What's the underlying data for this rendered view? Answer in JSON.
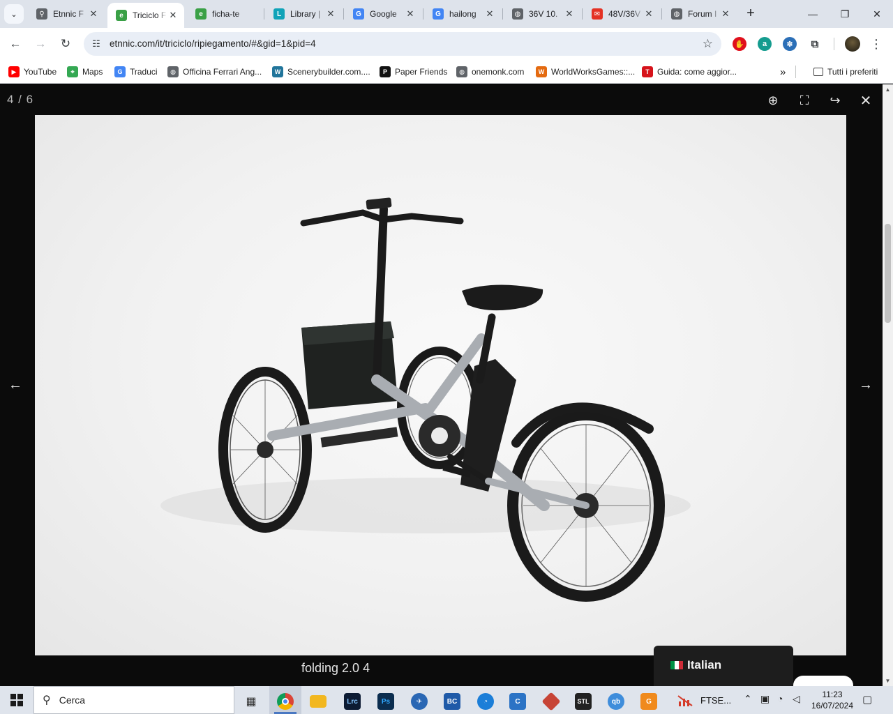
{
  "tabs": [
    {
      "title": "Etnnic F",
      "favicon": "bike-icon",
      "color": "#5f6368",
      "glyph": "⚲"
    },
    {
      "title": "Triciclo F",
      "favicon": "etnnic-e-icon",
      "color": "#3aa046",
      "glyph": "e",
      "active": true
    },
    {
      "title": "ficha-te",
      "favicon": "etnnic-e-icon",
      "color": "#3aa046",
      "glyph": "e"
    },
    {
      "title": "Library |",
      "favicon": "library-icon",
      "color": "#10a3b8",
      "glyph": "L"
    },
    {
      "title": "Google",
      "favicon": "google-lens-icon",
      "color": "#4285f4",
      "glyph": "G"
    },
    {
      "title": "hailong",
      "favicon": "google-icon",
      "color": "#4285f4",
      "glyph": "G"
    },
    {
      "title": "36V 10.",
      "favicon": "globe-icon",
      "color": "#5f6368",
      "glyph": "◍"
    },
    {
      "title": "48V/36V",
      "favicon": "aliexpress-icon",
      "color": "#e43225",
      "glyph": "✉"
    },
    {
      "title": "Forum I",
      "favicon": "globe-icon",
      "color": "#5f6368",
      "glyph": "◍"
    }
  ],
  "window": {
    "new_tab": "+",
    "minimize": "—",
    "restore": "❐",
    "close": "✕"
  },
  "toolbar": {
    "back": "←",
    "forward": "→",
    "reload": "↻",
    "url": "etnnic.com/it/triciclo/ripiegamento/#&gid=1&pid=4",
    "star": "☆",
    "extensions": [
      {
        "name": "adblock-icon",
        "color": "#e0101c",
        "glyph": "✋"
      },
      {
        "name": "amazon-assistant-icon",
        "color": "#159c8f",
        "glyph": "a"
      },
      {
        "name": "translate-extension-icon",
        "color": "#2b6fb7",
        "glyph": "✽"
      },
      {
        "name": "puzzle-icon",
        "color": "#ffffff",
        "glyph": "⧉"
      }
    ],
    "menu": "⋮"
  },
  "bookmarks": [
    {
      "label": "YouTube",
      "icon": "youtube-icon",
      "color": "#ff0000",
      "glyph": "▶"
    },
    {
      "label": "Maps",
      "icon": "maps-icon",
      "color": "#34a853",
      "glyph": "⌖"
    },
    {
      "label": "Traduci",
      "icon": "translate-icon",
      "color": "#4285f4",
      "glyph": "G"
    },
    {
      "label": "Officina Ferrari Ang...",
      "icon": "globe-icon",
      "color": "#5f6368",
      "glyph": "◍"
    },
    {
      "label": "Scenerybuilder.com....",
      "icon": "wordpress-icon",
      "color": "#21759b",
      "glyph": "W"
    },
    {
      "label": "Paper Friends",
      "icon": "paper-friends-icon",
      "color": "#111111",
      "glyph": "P"
    },
    {
      "label": "onemonk.com",
      "icon": "globe-icon",
      "color": "#5f6368",
      "glyph": "◍"
    },
    {
      "label": "WorldWorksGames::...",
      "icon": "worldworks-icon",
      "color": "#e46a10",
      "glyph": "W"
    },
    {
      "label": "Guida: come aggior...",
      "icon": "guida-icon",
      "color": "#d6131b",
      "glyph": "T"
    }
  ],
  "bookmarks_overflow": "»",
  "bookmarks_all": "Tutti i preferiti",
  "lightbox": {
    "counter": "4 / 6",
    "zoom": "⊕",
    "fullscreen": "⛶",
    "share": "↪",
    "close": "✕",
    "prev": "←",
    "next": "→",
    "caption": "folding 2.0 4",
    "image_alt": "Etnnic folding 2.0 electric tricycle"
  },
  "language": {
    "label": "Italian",
    "flag": [
      "#009246",
      "#ffffff",
      "#ce2b37"
    ]
  },
  "taskbar": {
    "search_placeholder": "Cerca",
    "apps": [
      {
        "name": "task-view-icon",
        "color": "#333333",
        "glyph": "▦"
      },
      {
        "name": "chrome-icon",
        "color": "#db4437",
        "glyph": "◉",
        "active": true
      },
      {
        "name": "file-explorer-icon",
        "color": "#f2b71f",
        "glyph": "▬"
      },
      {
        "name": "lightroom-icon",
        "color": "#0c1b33",
        "glyph": "Lrc"
      },
      {
        "name": "photoshop-icon",
        "color": "#0b2d4f",
        "glyph": "Ps"
      },
      {
        "name": "flight-app-icon",
        "color": "#2a67b4",
        "glyph": "✈"
      },
      {
        "name": "bc-app-icon",
        "color": "#1f5aa8",
        "glyph": "BC"
      },
      {
        "name": "edge-icon",
        "color": "#1b7ed8",
        "glyph": "◔"
      },
      {
        "name": "c-app-icon",
        "color": "#2b73c5",
        "glyph": "C"
      },
      {
        "name": "3d-app-icon",
        "color": "#c74436",
        "glyph": "◆"
      },
      {
        "name": "stl-app-icon",
        "color": "#222222",
        "glyph": "STL"
      },
      {
        "name": "qbittorrent-icon",
        "color": "#3f8ddb",
        "glyph": "qb"
      },
      {
        "name": "g-app-icon",
        "color": "#f08a1c",
        "glyph": "G"
      }
    ],
    "ftse_label": "FTSE...",
    "tray": {
      "chevron": "⌃",
      "meet": "▣",
      "wifi": "◔",
      "volume": "◁"
    },
    "time": "11:23",
    "date": "16/07/2024",
    "notifications": "▢"
  }
}
